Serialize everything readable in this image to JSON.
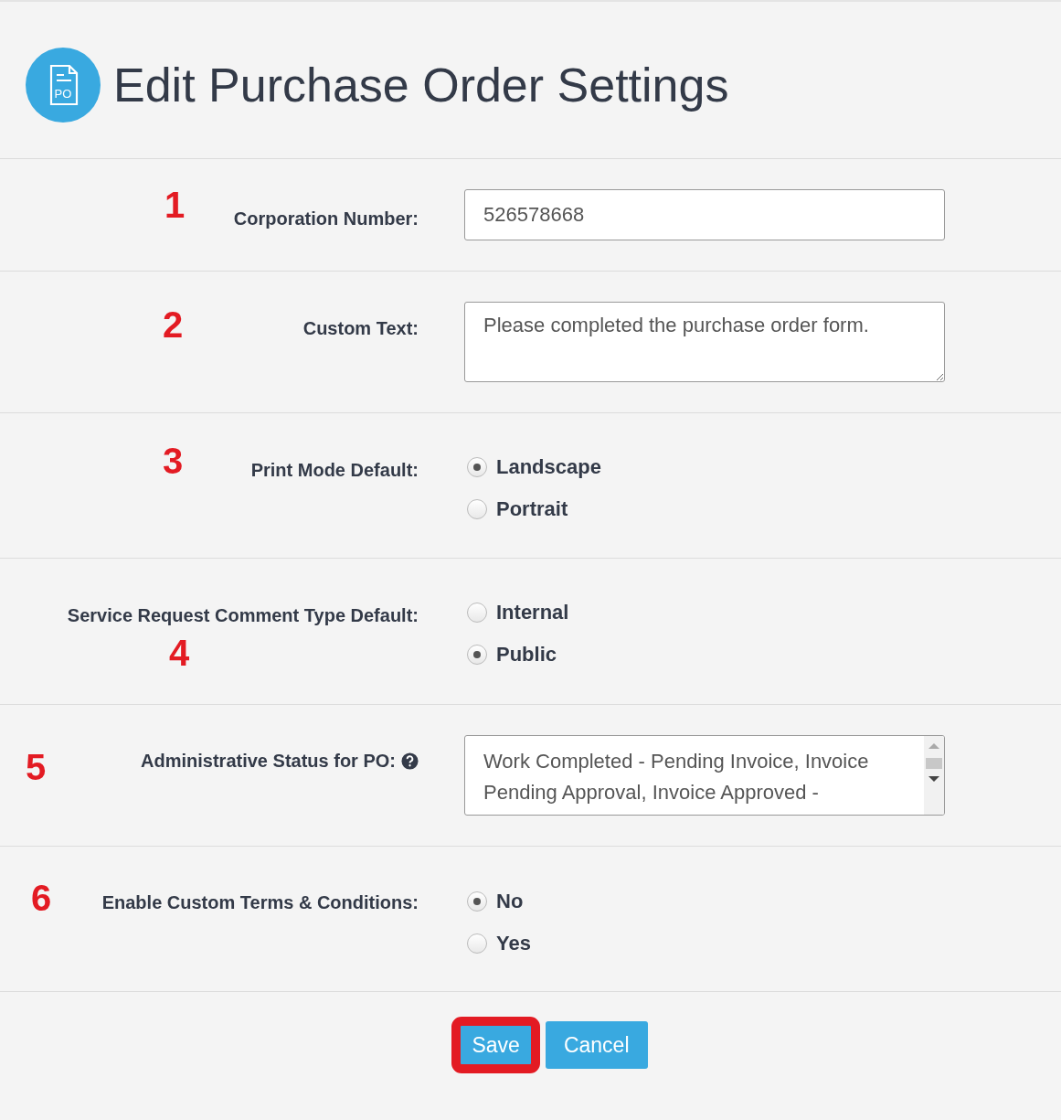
{
  "header": {
    "title": "Edit Purchase Order Settings",
    "icon_text": "PO"
  },
  "fields": [
    {
      "kind": "text",
      "label": "Corporation Number:",
      "step": "1",
      "value": "526578668"
    },
    {
      "kind": "textarea",
      "label": "Custom Text:",
      "step": "2",
      "value": "Please completed the purchase order form."
    },
    {
      "kind": "radio",
      "label": "Print Mode Default:",
      "step": "3",
      "options": [
        {
          "label": "Landscape",
          "selected": true
        },
        {
          "label": "Portrait",
          "selected": false
        }
      ]
    },
    {
      "kind": "radio",
      "label": "Service Request Comment Type Default:",
      "step": "4",
      "options": [
        {
          "label": "Internal",
          "selected": false
        },
        {
          "label": "Public",
          "selected": true
        }
      ]
    },
    {
      "kind": "listbox",
      "label": "Administrative Status for PO:",
      "step": "5",
      "help": true,
      "value": "Work Completed - Pending Invoice, Invoice Pending Approval, Invoice Approved -"
    },
    {
      "kind": "radio",
      "label": "Enable Custom Terms & Conditions:",
      "step": "6",
      "options": [
        {
          "label": "No",
          "selected": true
        },
        {
          "label": "Yes",
          "selected": false
        }
      ]
    }
  ],
  "buttons": [
    {
      "label": "Save",
      "highlighted": true
    },
    {
      "label": "Cancel",
      "highlighted": false
    }
  ]
}
